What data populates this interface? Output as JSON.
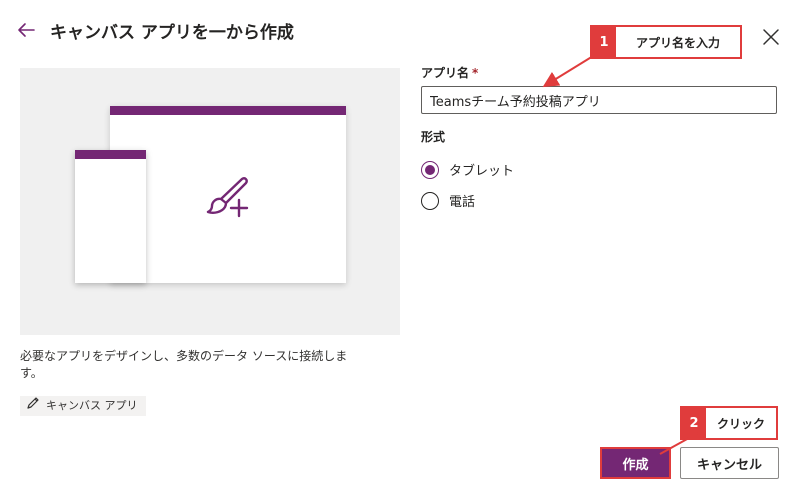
{
  "header": {
    "title": "キャンバス アプリを一から作成"
  },
  "template": {
    "description": "必要なアプリをデザインし、多数のデータ ソースに接続します。",
    "tag_label": "キャンバス アプリ"
  },
  "form": {
    "app_name_label": "アプリ名",
    "required_mark": "*",
    "app_name_value": "Teamsチーム予約投稿アプリ",
    "format_label": "形式",
    "format_options": [
      {
        "label": "タブレット",
        "selected": true
      },
      {
        "label": "電話",
        "selected": false
      }
    ]
  },
  "footer": {
    "create_label": "作成",
    "cancel_label": "キャンセル"
  },
  "annotations": [
    {
      "number": "1",
      "text": "アプリ名を入力"
    },
    {
      "number": "2",
      "text": "クリック"
    }
  ],
  "colors": {
    "accent": "#742774",
    "annotation": "#e03c3c"
  },
  "icons": [
    "back-arrow-icon",
    "close-icon",
    "paintbrush-plus-icon",
    "pencil-icon"
  ]
}
